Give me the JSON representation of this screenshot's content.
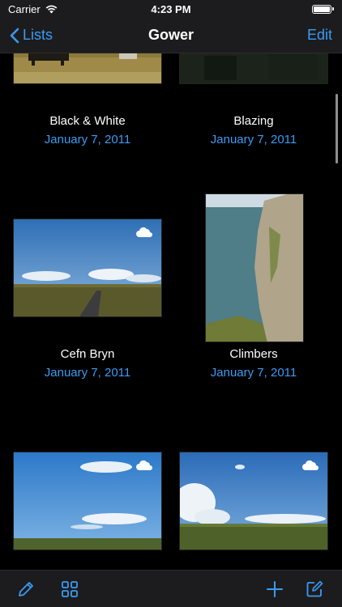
{
  "status": {
    "carrier": "Carrier",
    "time": "4:23 PM"
  },
  "nav": {
    "back_label": "Lists",
    "title": "Gower",
    "edit_label": "Edit"
  },
  "items": [
    {
      "title": "Black & White",
      "date": "January 7, 2011",
      "cloud": false
    },
    {
      "title": "Blazing",
      "date": "January 7, 2011",
      "cloud": false
    },
    {
      "title": "Cefn Bryn",
      "date": "January 7, 2011",
      "cloud": true
    },
    {
      "title": "Climbers",
      "date": "January 7, 2011",
      "cloud": false
    },
    {
      "title": "",
      "date": "",
      "cloud": true
    },
    {
      "title": "",
      "date": "",
      "cloud": true
    }
  ],
  "toolbar": {
    "icons": [
      "pencil-icon",
      "grid-icon",
      "plus-icon",
      "compose-icon"
    ]
  },
  "colors": {
    "accent": "#3a9bf4",
    "bar": "#1c1c1e",
    "background": "#000000"
  }
}
